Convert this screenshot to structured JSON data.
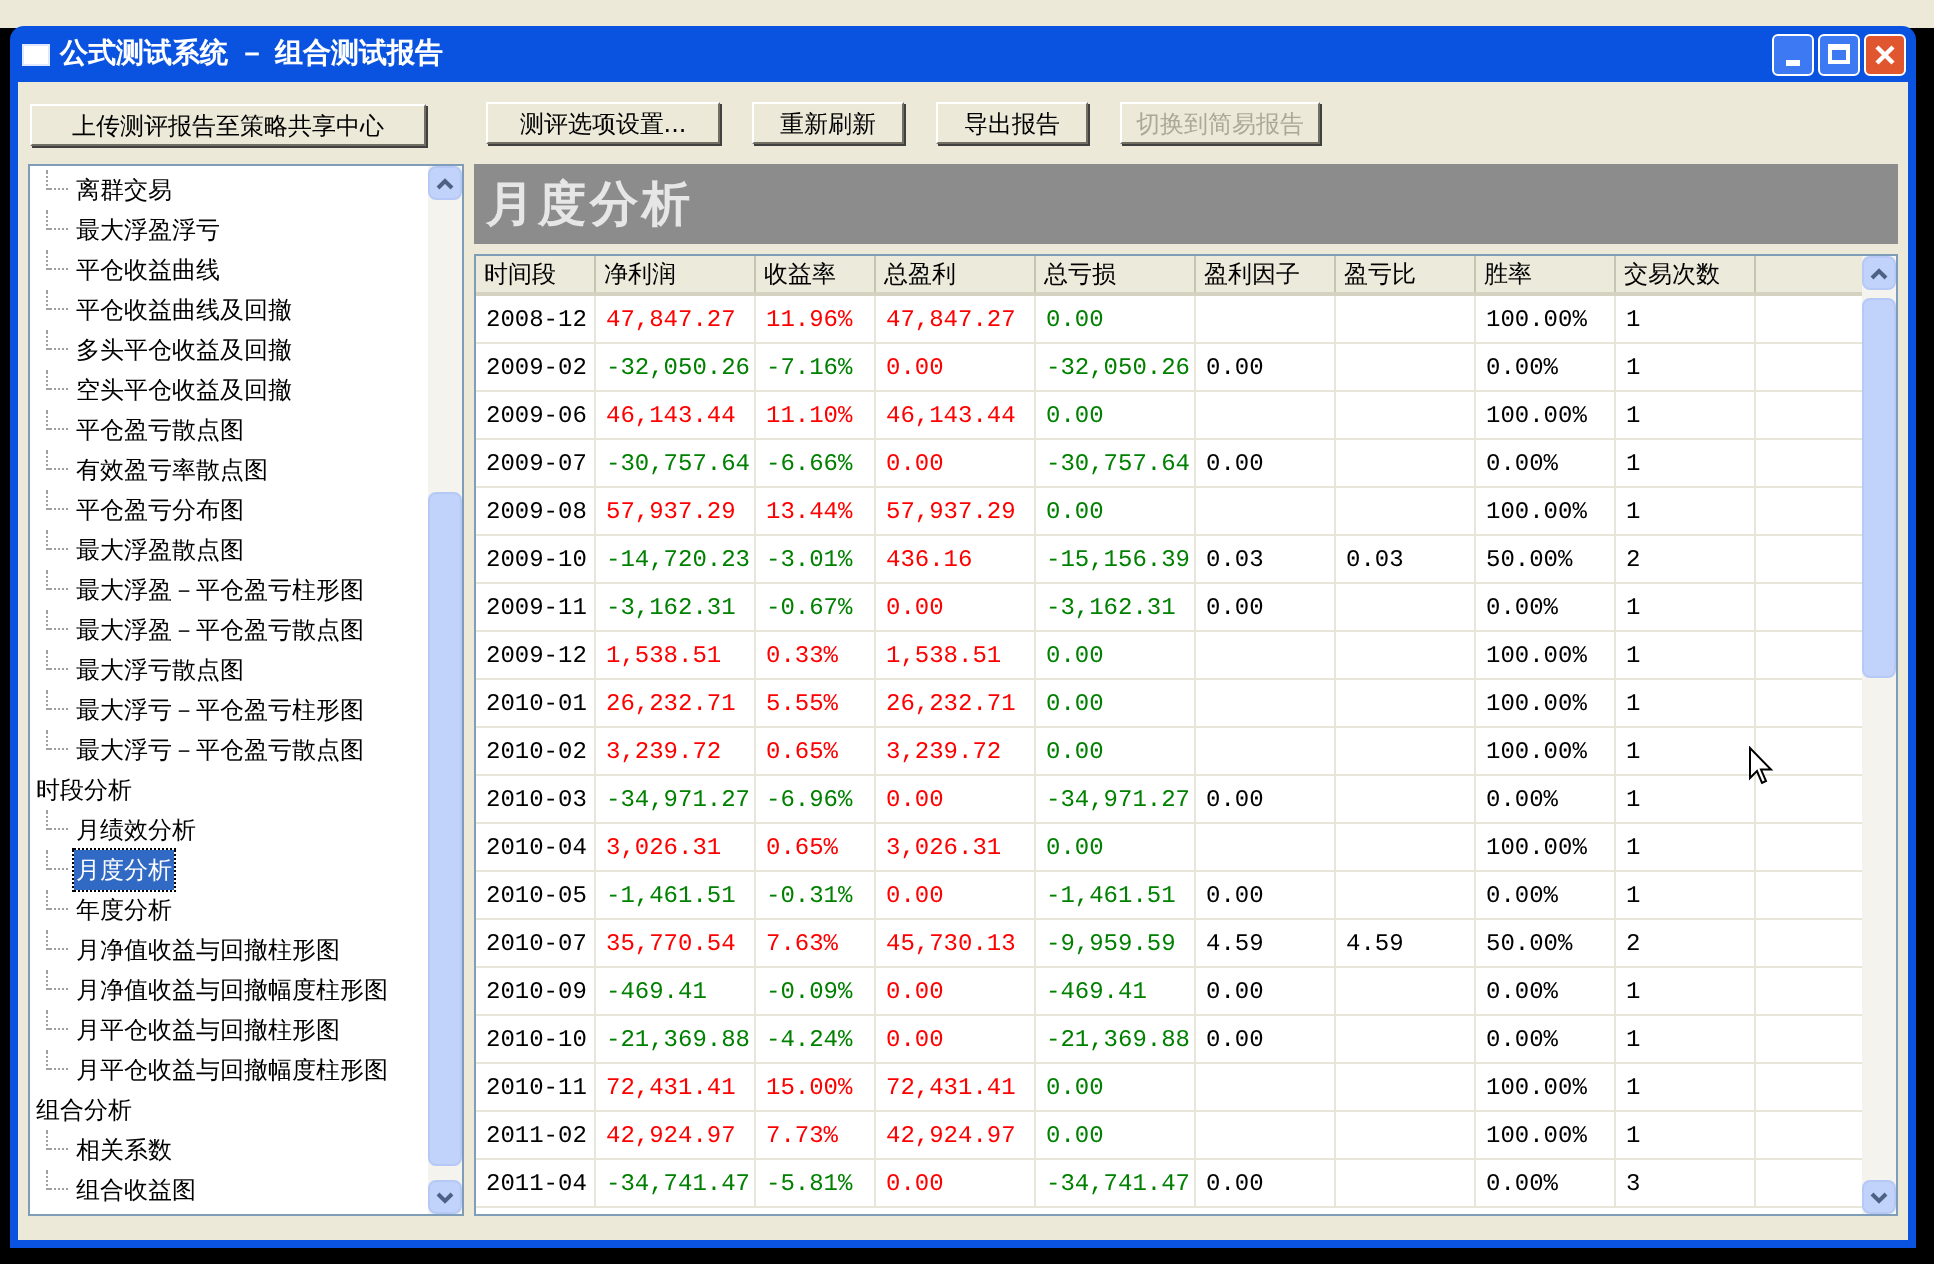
{
  "window": {
    "title": "公式测试系统 － 组合测试报告"
  },
  "toolbar": {
    "upload": {
      "label": "上传测评报告至策略共享中心",
      "disabled": false
    },
    "buttons": [
      {
        "label": "测评选项设置...",
        "disabled": false
      },
      {
        "label": "重新刷新",
        "disabled": false
      },
      {
        "label": "导出报告",
        "disabled": false
      },
      {
        "label": "切换到简易报告",
        "disabled": true
      }
    ]
  },
  "tree": [
    {
      "children": [
        {
          "label": "离群交易",
          "selected": false
        },
        {
          "label": "最大浮盈浮亏",
          "selected": false
        },
        {
          "label": "平仓收益曲线",
          "selected": false
        },
        {
          "label": "平仓收益曲线及回撤",
          "selected": false
        },
        {
          "label": "多头平仓收益及回撤",
          "selected": false
        },
        {
          "label": "空头平仓收益及回撤",
          "selected": false
        },
        {
          "label": "平仓盈亏散点图",
          "selected": false
        },
        {
          "label": "有效盈亏率散点图",
          "selected": false
        },
        {
          "label": "平仓盈亏分布图",
          "selected": false
        },
        {
          "label": "最大浮盈散点图",
          "selected": false
        },
        {
          "label": "最大浮盈－平仓盈亏柱形图",
          "selected": false
        },
        {
          "label": "最大浮盈－平仓盈亏散点图",
          "selected": false
        },
        {
          "label": "最大浮亏散点图",
          "selected": false
        },
        {
          "label": "最大浮亏－平仓盈亏柱形图",
          "selected": false
        },
        {
          "label": "最大浮亏－平仓盈亏散点图",
          "selected": false
        }
      ]
    },
    {
      "label": "时段分析",
      "children": [
        {
          "label": "月绩效分析",
          "selected": false
        },
        {
          "label": "月度分析",
          "selected": true
        },
        {
          "label": "年度分析",
          "selected": false
        },
        {
          "label": "月净值收益与回撤柱形图",
          "selected": false
        },
        {
          "label": "月净值收益与回撤幅度柱形图",
          "selected": false
        },
        {
          "label": "月平仓收益与回撤柱形图",
          "selected": false
        },
        {
          "label": "月平仓收益与回撤幅度柱形图",
          "selected": false
        }
      ]
    },
    {
      "label": "组合分析",
      "children": [
        {
          "label": "相关系数",
          "selected": false
        },
        {
          "label": "组合收益图",
          "selected": false
        }
      ]
    }
  ],
  "report": {
    "title": "月度分析",
    "table": {
      "columns": [
        "时间段",
        "净利润",
        "收益率",
        "总盈利",
        "总亏损",
        "盈利因子",
        "盈亏比",
        "胜率",
        "交易次数"
      ],
      "rows": [
        [
          {
            "text": "2008-12",
            "color": "#000000"
          },
          {
            "text": "47,847.27",
            "color": "#ff0000"
          },
          {
            "text": "11.96%",
            "color": "#ff0000"
          },
          {
            "text": "47,847.27",
            "color": "#ff0000"
          },
          {
            "text": "0.00",
            "color": "#008000"
          },
          null,
          null,
          {
            "text": "100.00%",
            "color": "#000000"
          },
          {
            "text": "1",
            "color": "#000000"
          }
        ],
        [
          {
            "text": "2009-02",
            "color": "#000000"
          },
          {
            "text": "-32,050.26",
            "color": "#008000"
          },
          {
            "text": "-7.16%",
            "color": "#008000"
          },
          {
            "text": "0.00",
            "color": "#ff0000"
          },
          {
            "text": "-32,050.26",
            "color": "#008000"
          },
          {
            "text": "0.00",
            "color": "#000000"
          },
          null,
          {
            "text": "0.00%",
            "color": "#000000"
          },
          {
            "text": "1",
            "color": "#000000"
          }
        ],
        [
          {
            "text": "2009-06",
            "color": "#000000"
          },
          {
            "text": "46,143.44",
            "color": "#ff0000"
          },
          {
            "text": "11.10%",
            "color": "#ff0000"
          },
          {
            "text": "46,143.44",
            "color": "#ff0000"
          },
          {
            "text": "0.00",
            "color": "#008000"
          },
          null,
          null,
          {
            "text": "100.00%",
            "color": "#000000"
          },
          {
            "text": "1",
            "color": "#000000"
          }
        ],
        [
          {
            "text": "2009-07",
            "color": "#000000"
          },
          {
            "text": "-30,757.64",
            "color": "#008000"
          },
          {
            "text": "-6.66%",
            "color": "#008000"
          },
          {
            "text": "0.00",
            "color": "#ff0000"
          },
          {
            "text": "-30,757.64",
            "color": "#008000"
          },
          {
            "text": "0.00",
            "color": "#000000"
          },
          null,
          {
            "text": "0.00%",
            "color": "#000000"
          },
          {
            "text": "1",
            "color": "#000000"
          }
        ],
        [
          {
            "text": "2009-08",
            "color": "#000000"
          },
          {
            "text": "57,937.29",
            "color": "#ff0000"
          },
          {
            "text": "13.44%",
            "color": "#ff0000"
          },
          {
            "text": "57,937.29",
            "color": "#ff0000"
          },
          {
            "text": "0.00",
            "color": "#008000"
          },
          null,
          null,
          {
            "text": "100.00%",
            "color": "#000000"
          },
          {
            "text": "1",
            "color": "#000000"
          }
        ],
        [
          {
            "text": "2009-10",
            "color": "#000000"
          },
          {
            "text": "-14,720.23",
            "color": "#008000"
          },
          {
            "text": "-3.01%",
            "color": "#008000"
          },
          {
            "text": "436.16",
            "color": "#ff0000"
          },
          {
            "text": "-15,156.39",
            "color": "#008000"
          },
          {
            "text": "0.03",
            "color": "#000000"
          },
          {
            "text": "0.03",
            "color": "#000000"
          },
          {
            "text": "50.00%",
            "color": "#000000"
          },
          {
            "text": "2",
            "color": "#000000"
          }
        ],
        [
          {
            "text": "2009-11",
            "color": "#000000"
          },
          {
            "text": "-3,162.31",
            "color": "#008000"
          },
          {
            "text": "-0.67%",
            "color": "#008000"
          },
          {
            "text": "0.00",
            "color": "#ff0000"
          },
          {
            "text": "-3,162.31",
            "color": "#008000"
          },
          {
            "text": "0.00",
            "color": "#000000"
          },
          null,
          {
            "text": "0.00%",
            "color": "#000000"
          },
          {
            "text": "1",
            "color": "#000000"
          }
        ],
        [
          {
            "text": "2009-12",
            "color": "#000000"
          },
          {
            "text": "1,538.51",
            "color": "#ff0000"
          },
          {
            "text": "0.33%",
            "color": "#ff0000"
          },
          {
            "text": "1,538.51",
            "color": "#ff0000"
          },
          {
            "text": "0.00",
            "color": "#008000"
          },
          null,
          null,
          {
            "text": "100.00%",
            "color": "#000000"
          },
          {
            "text": "1",
            "color": "#000000"
          }
        ],
        [
          {
            "text": "2010-01",
            "color": "#000000"
          },
          {
            "text": "26,232.71",
            "color": "#ff0000"
          },
          {
            "text": "5.55%",
            "color": "#ff0000"
          },
          {
            "text": "26,232.71",
            "color": "#ff0000"
          },
          {
            "text": "0.00",
            "color": "#008000"
          },
          null,
          null,
          {
            "text": "100.00%",
            "color": "#000000"
          },
          {
            "text": "1",
            "color": "#000000"
          }
        ],
        [
          {
            "text": "2010-02",
            "color": "#000000"
          },
          {
            "text": "3,239.72",
            "color": "#ff0000"
          },
          {
            "text": "0.65%",
            "color": "#ff0000"
          },
          {
            "text": "3,239.72",
            "color": "#ff0000"
          },
          {
            "text": "0.00",
            "color": "#008000"
          },
          null,
          null,
          {
            "text": "100.00%",
            "color": "#000000"
          },
          {
            "text": "1",
            "color": "#000000"
          }
        ],
        [
          {
            "text": "2010-03",
            "color": "#000000"
          },
          {
            "text": "-34,971.27",
            "color": "#008000"
          },
          {
            "text": "-6.96%",
            "color": "#008000"
          },
          {
            "text": "0.00",
            "color": "#ff0000"
          },
          {
            "text": "-34,971.27",
            "color": "#008000"
          },
          {
            "text": "0.00",
            "color": "#000000"
          },
          null,
          {
            "text": "0.00%",
            "color": "#000000"
          },
          {
            "text": "1",
            "color": "#000000"
          }
        ],
        [
          {
            "text": "2010-04",
            "color": "#000000"
          },
          {
            "text": "3,026.31",
            "color": "#ff0000"
          },
          {
            "text": "0.65%",
            "color": "#ff0000"
          },
          {
            "text": "3,026.31",
            "color": "#ff0000"
          },
          {
            "text": "0.00",
            "color": "#008000"
          },
          null,
          null,
          {
            "text": "100.00%",
            "color": "#000000"
          },
          {
            "text": "1",
            "color": "#000000"
          }
        ],
        [
          {
            "text": "2010-05",
            "color": "#000000"
          },
          {
            "text": "-1,461.51",
            "color": "#008000"
          },
          {
            "text": "-0.31%",
            "color": "#008000"
          },
          {
            "text": "0.00",
            "color": "#ff0000"
          },
          {
            "text": "-1,461.51",
            "color": "#008000"
          },
          {
            "text": "0.00",
            "color": "#000000"
          },
          null,
          {
            "text": "0.00%",
            "color": "#000000"
          },
          {
            "text": "1",
            "color": "#000000"
          }
        ],
        [
          {
            "text": "2010-07",
            "color": "#000000"
          },
          {
            "text": "35,770.54",
            "color": "#ff0000"
          },
          {
            "text": "7.63%",
            "color": "#ff0000"
          },
          {
            "text": "45,730.13",
            "color": "#ff0000"
          },
          {
            "text": "-9,959.59",
            "color": "#008000"
          },
          {
            "text": "4.59",
            "color": "#000000"
          },
          {
            "text": "4.59",
            "color": "#000000"
          },
          {
            "text": "50.00%",
            "color": "#000000"
          },
          {
            "text": "2",
            "color": "#000000"
          }
        ],
        [
          {
            "text": "2010-09",
            "color": "#000000"
          },
          {
            "text": "-469.41",
            "color": "#008000"
          },
          {
            "text": "-0.09%",
            "color": "#008000"
          },
          {
            "text": "0.00",
            "color": "#ff0000"
          },
          {
            "text": "-469.41",
            "color": "#008000"
          },
          {
            "text": "0.00",
            "color": "#000000"
          },
          null,
          {
            "text": "0.00%",
            "color": "#000000"
          },
          {
            "text": "1",
            "color": "#000000"
          }
        ],
        [
          {
            "text": "2010-10",
            "color": "#000000"
          },
          {
            "text": "-21,369.88",
            "color": "#008000"
          },
          {
            "text": "-4.24%",
            "color": "#008000"
          },
          {
            "text": "0.00",
            "color": "#ff0000"
          },
          {
            "text": "-21,369.88",
            "color": "#008000"
          },
          {
            "text": "0.00",
            "color": "#000000"
          },
          null,
          {
            "text": "0.00%",
            "color": "#000000"
          },
          {
            "text": "1",
            "color": "#000000"
          }
        ],
        [
          {
            "text": "2010-11",
            "color": "#000000"
          },
          {
            "text": "72,431.41",
            "color": "#ff0000"
          },
          {
            "text": "15.00%",
            "color": "#ff0000"
          },
          {
            "text": "72,431.41",
            "color": "#ff0000"
          },
          {
            "text": "0.00",
            "color": "#008000"
          },
          null,
          null,
          {
            "text": "100.00%",
            "color": "#000000"
          },
          {
            "text": "1",
            "color": "#000000"
          }
        ],
        [
          {
            "text": "2011-02",
            "color": "#000000"
          },
          {
            "text": "42,924.97",
            "color": "#ff0000"
          },
          {
            "text": "7.73%",
            "color": "#ff0000"
          },
          {
            "text": "42,924.97",
            "color": "#ff0000"
          },
          {
            "text": "0.00",
            "color": "#008000"
          },
          null,
          null,
          {
            "text": "100.00%",
            "color": "#000000"
          },
          {
            "text": "1",
            "color": "#000000"
          }
        ],
        [
          {
            "text": "2011-04",
            "color": "#000000"
          },
          {
            "text": "-34,741.47",
            "color": "#008000"
          },
          {
            "text": "-5.81%",
            "color": "#008000"
          },
          {
            "text": "0.00",
            "color": "#ff0000"
          },
          {
            "text": "-34,741.47",
            "color": "#008000"
          },
          {
            "text": "0.00",
            "color": "#000000"
          },
          null,
          {
            "text": "0.00%",
            "color": "#000000"
          },
          {
            "text": "3",
            "color": "#000000"
          }
        ]
      ]
    }
  }
}
